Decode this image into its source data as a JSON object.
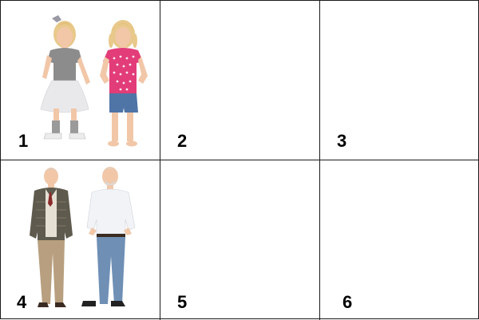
{
  "panels": [
    {
      "number": "1",
      "content": "two-young-girls"
    },
    {
      "number": "2",
      "content": "empty"
    },
    {
      "number": "3",
      "content": "empty"
    },
    {
      "number": "4",
      "content": "two-elderly-men"
    },
    {
      "number": "5",
      "content": "empty"
    },
    {
      "number": "6",
      "content": "empty"
    }
  ],
  "colors": {
    "border": "#1a1a1a",
    "girl_shirt_gray": "#8c8c8c",
    "girl_skirt_white": "#e9e9ec",
    "girl_top_pink": "#e23d79",
    "denim_shorts": "#4f74a6",
    "cardigan": "#5e5a4e",
    "khaki_pants": "#b89f7f",
    "white_shirt": "#f1f3f6",
    "jeans": "#6f8fb5",
    "hair_blonde": "#e8c98b",
    "hair_gray": "#cfcfcf",
    "skin": "#f1c7a8"
  }
}
